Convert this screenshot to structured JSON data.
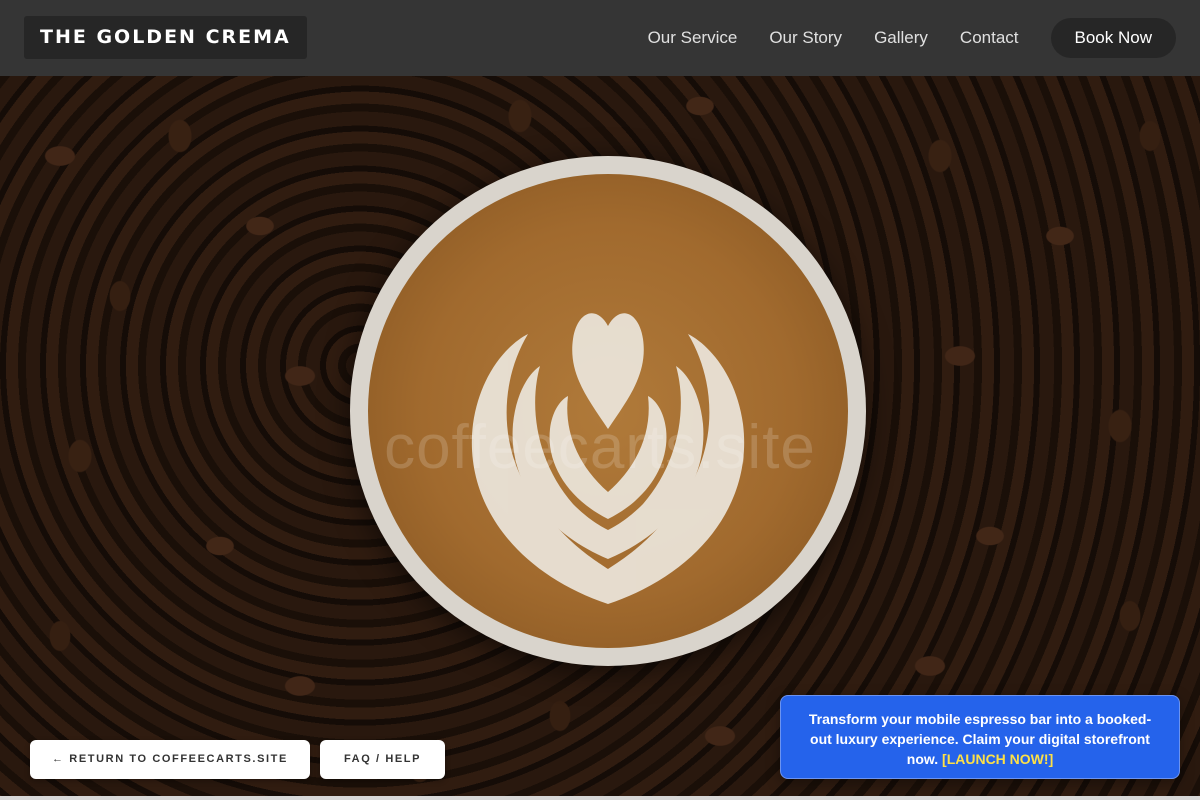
{
  "header": {
    "brand": "THE GOLDEN CREMA",
    "nav": [
      "Our Service",
      "Our Story",
      "Gallery",
      "Contact"
    ],
    "book_button": "Book Now"
  },
  "hero": {
    "watermark": "coffeecarts.site"
  },
  "buttons": {
    "return": "← RETURN TO COFFEECARTS.SITE",
    "faq": "FAQ / HELP"
  },
  "promo": {
    "text": "Transform your mobile espresso bar into a booked-out luxury experience. Claim your digital storefront now.",
    "cta": "[LAUNCH NOW!]"
  },
  "colors": {
    "header_bg": "#353535",
    "promo_bg": "#2563eb",
    "promo_cta": "#fde047"
  }
}
